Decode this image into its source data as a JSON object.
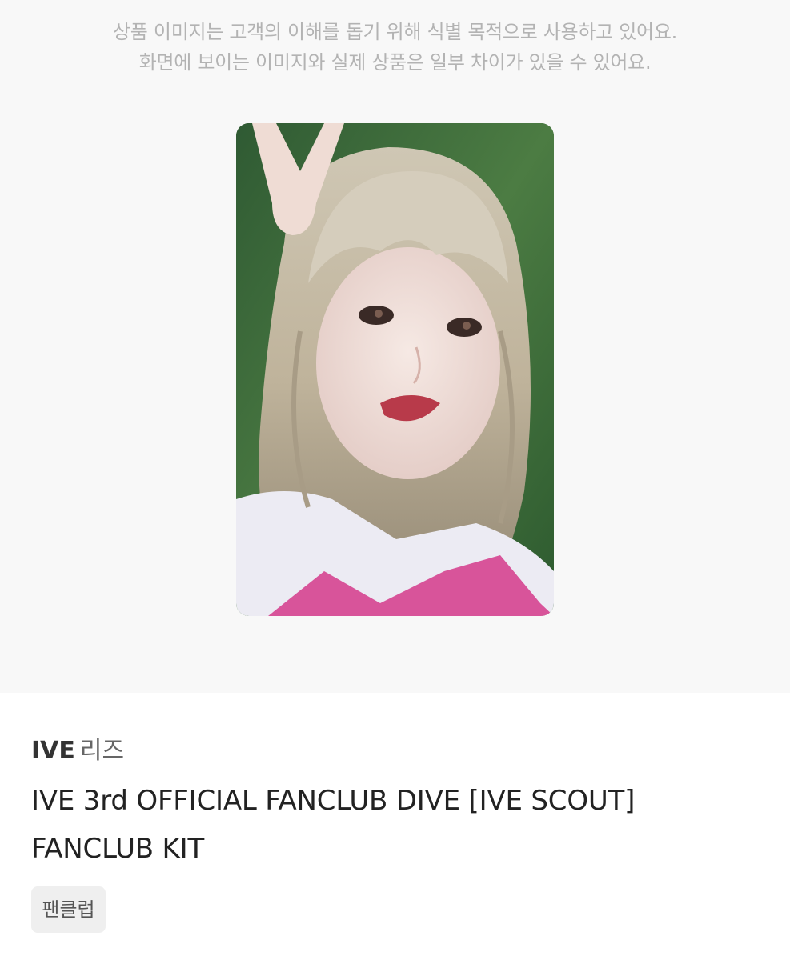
{
  "notice": {
    "line1": "상품 이미지는 고객의 이해를 돕기 위해 식별 목적으로 사용하고 있어요.",
    "line2": "화면에 보이는 이미지와 실제 상품은 일부 차이가 있을 수 있어요."
  },
  "product": {
    "artist": "IVE",
    "member": "리즈",
    "title": "IVE 3rd OFFICIAL FANCLUB DIVE [IVE SCOUT] FANCLUB KIT",
    "tag": "팬클럽"
  }
}
